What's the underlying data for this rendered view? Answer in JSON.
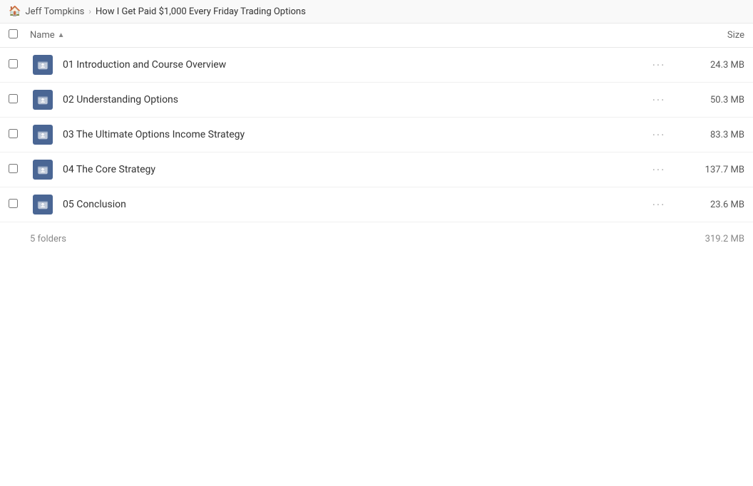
{
  "breadcrumb": {
    "home_label": "Jeff Tompkins",
    "separator": "›",
    "current": "How I Get Paid $1,000 Every Friday Trading Options"
  },
  "table": {
    "header": {
      "checkbox_label": "",
      "name_label": "Name",
      "sort_icon": "▲",
      "size_label": "Size"
    },
    "rows": [
      {
        "name": "01 Introduction and Course Overview",
        "size": "24.3 MB",
        "actions": "···"
      },
      {
        "name": "02 Understanding Options",
        "size": "50.3 MB",
        "actions": "···"
      },
      {
        "name": "03 The Ultimate Options Income Strategy",
        "size": "83.3 MB",
        "actions": "···"
      },
      {
        "name": "04 The Core Strategy",
        "size": "137.7 MB",
        "actions": "···"
      },
      {
        "name": "05 Conclusion",
        "size": "23.6 MB",
        "actions": "···"
      }
    ],
    "footer": {
      "count_label": "5 folders",
      "total_size": "319.2 MB"
    }
  },
  "colors": {
    "folder_bg": "#4a6694",
    "header_bg": "#f9f9f9",
    "row_border": "#f0f0f0"
  }
}
